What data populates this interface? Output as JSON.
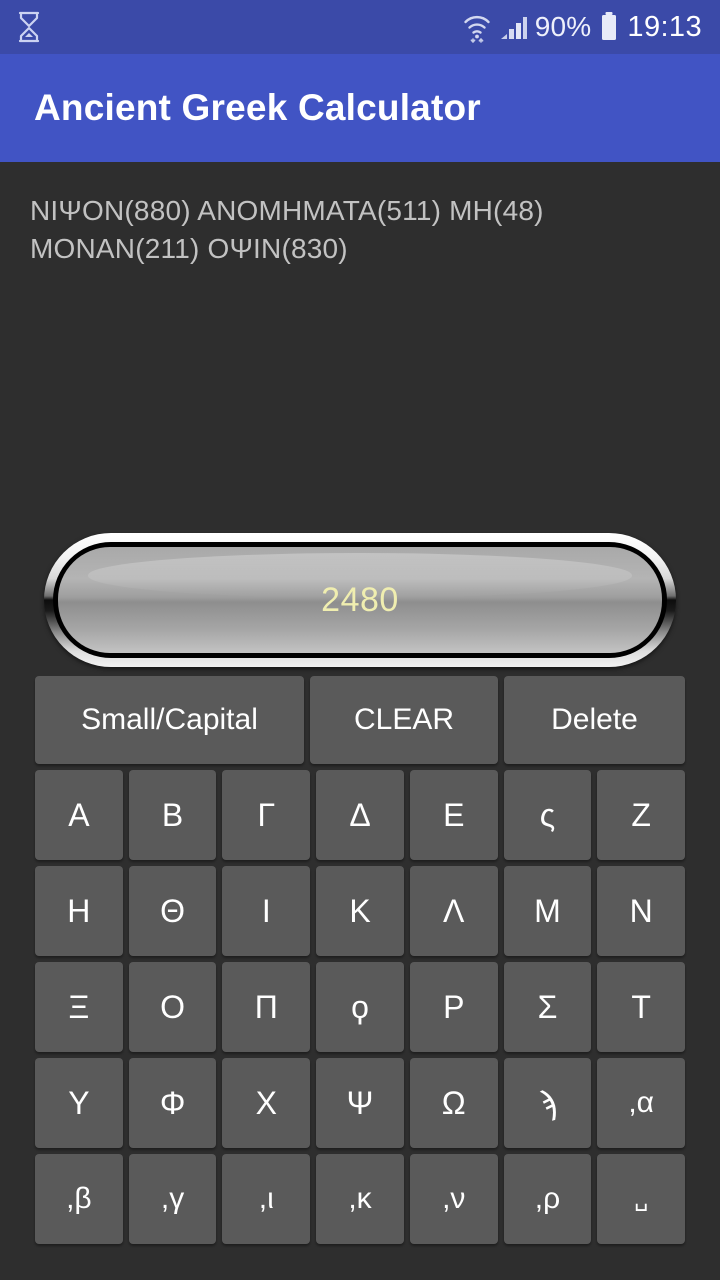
{
  "status_bar": {
    "left_icons": [
      {
        "name": "hourglass-icon",
        "glyph": "hourglass"
      }
    ],
    "right_icons": [
      {
        "name": "wifi-icon",
        "glyph": "wifi"
      },
      {
        "name": "cellular-signal-icon",
        "glyph": "signal"
      }
    ],
    "battery_percent": "90%",
    "battery_icon": "battery-icon",
    "clock": "19:13",
    "background_color": "#3b4aa8"
  },
  "app_bar": {
    "title": "Ancient Greek Calculator",
    "background_color": "#4154c4",
    "text_color": "#ffffff"
  },
  "expression": {
    "text": "ΝΙΨΟΝ(880) ΑΝΟΜΗΜΑΤΑ(511) ΜΗ(48) ΜΟΝΑΝ(211) ΟΨΙΝ(830)",
    "text_color": "#c2c2c2"
  },
  "display": {
    "value": "2480",
    "value_color": "#f0eeb0",
    "bezel_style": "chrome-metallic"
  },
  "function_keys": [
    {
      "label": "Small/Capital",
      "name": "small-capital-button",
      "size": "wide"
    },
    {
      "label": "CLEAR",
      "name": "clear-button",
      "size": "mid"
    },
    {
      "label": "Delete",
      "name": "delete-button",
      "size": "small"
    }
  ],
  "keypad_rows": [
    [
      {
        "label": "Α",
        "name": "key-alpha"
      },
      {
        "label": "Β",
        "name": "key-beta"
      },
      {
        "label": "Γ",
        "name": "key-gamma"
      },
      {
        "label": "Δ",
        "name": "key-delta"
      },
      {
        "label": "Ε",
        "name": "key-epsilon"
      },
      {
        "label": "ς",
        "name": "key-stigma"
      },
      {
        "label": "Ζ",
        "name": "key-zeta"
      }
    ],
    [
      {
        "label": "Η",
        "name": "key-eta"
      },
      {
        "label": "Θ",
        "name": "key-theta"
      },
      {
        "label": "Ι",
        "name": "key-iota"
      },
      {
        "label": "Κ",
        "name": "key-kappa"
      },
      {
        "label": "Λ",
        "name": "key-lambda"
      },
      {
        "label": "Μ",
        "name": "key-mu"
      },
      {
        "label": "Ν",
        "name": "key-nu"
      }
    ],
    [
      {
        "label": "Ξ",
        "name": "key-xi"
      },
      {
        "label": "Ο",
        "name": "key-omicron"
      },
      {
        "label": "Π",
        "name": "key-pi"
      },
      {
        "label": "ϙ",
        "name": "key-koppa"
      },
      {
        "label": "Ρ",
        "name": "key-rho"
      },
      {
        "label": "Σ",
        "name": "key-sigma"
      },
      {
        "label": "Τ",
        "name": "key-tau"
      }
    ],
    [
      {
        "label": "Υ",
        "name": "key-upsilon"
      },
      {
        "label": "Φ",
        "name": "key-phi"
      },
      {
        "label": "Χ",
        "name": "key-chi"
      },
      {
        "label": "Ψ",
        "name": "key-psi"
      },
      {
        "label": "Ω",
        "name": "key-omega"
      },
      {
        "label": "ϡ",
        "name": "key-sampi"
      },
      {
        "label": ",α",
        "name": "key-thousand-alpha"
      }
    ],
    [
      {
        "label": ",β",
        "name": "key-thousand-beta"
      },
      {
        "label": ",γ",
        "name": "key-thousand-gamma"
      },
      {
        "label": ",ι",
        "name": "key-thousand-iota"
      },
      {
        "label": ",κ",
        "name": "key-thousand-kappa"
      },
      {
        "label": ",ν",
        "name": "key-thousand-nu"
      },
      {
        "label": ",ρ",
        "name": "key-thousand-rho"
      },
      {
        "label": "␣",
        "name": "key-space"
      }
    ]
  ],
  "theme": {
    "screen_background": "#2e2e2e",
    "key_background": "#5a5a5a",
    "key_text": "#ffffff"
  }
}
